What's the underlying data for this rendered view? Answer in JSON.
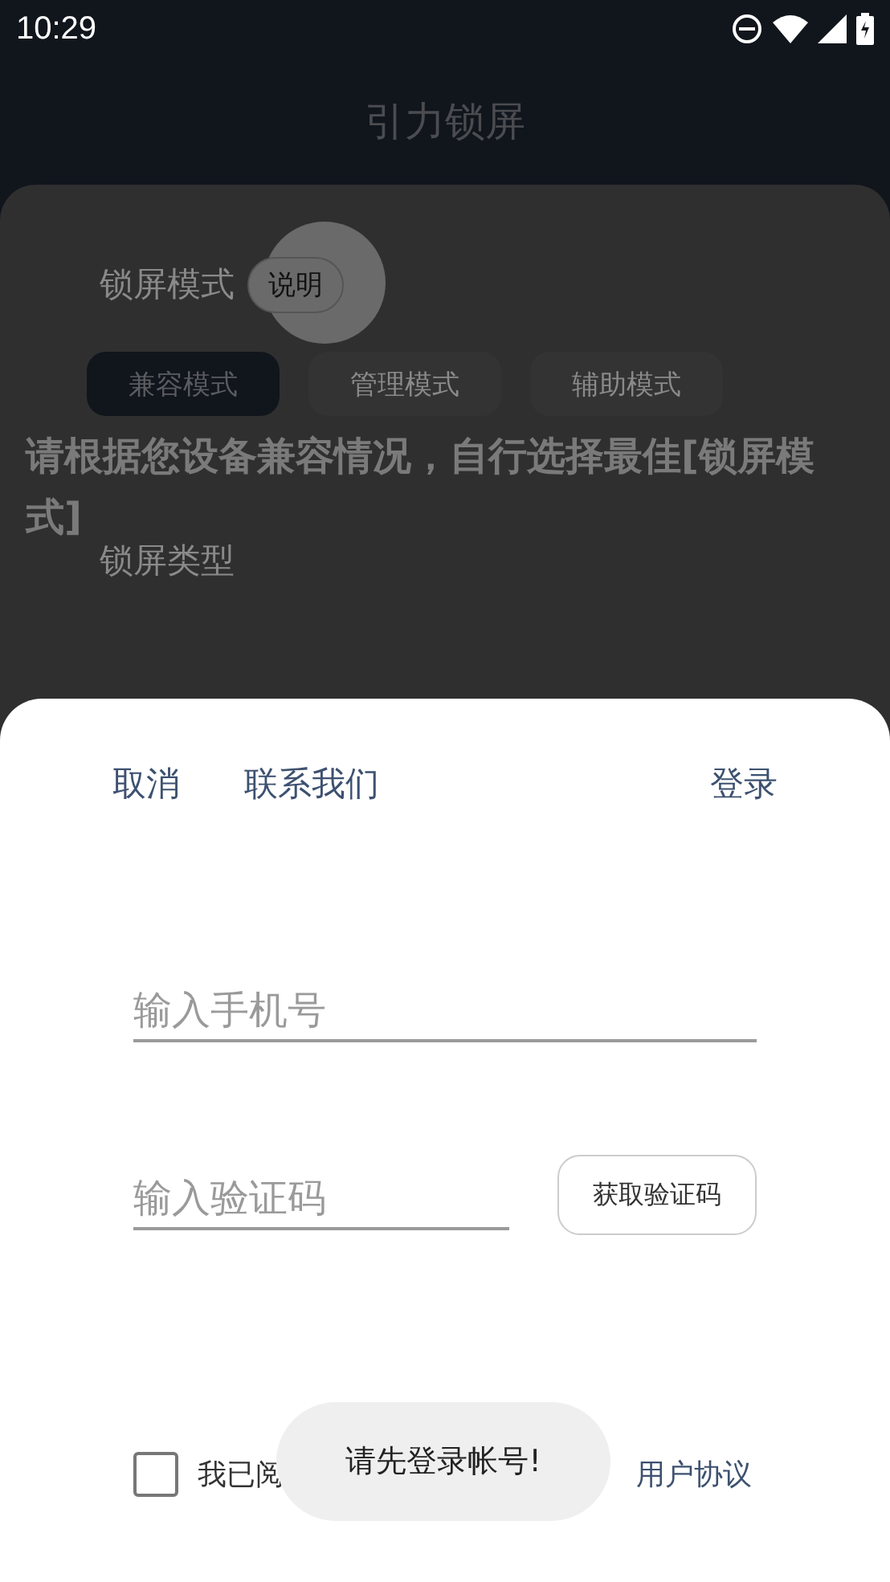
{
  "status_bar": {
    "time": "10:29"
  },
  "header": {
    "title": "引力锁屏"
  },
  "background": {
    "mode_label": "锁屏模式",
    "help_button": "说明",
    "modes": [
      {
        "label": "兼容模式",
        "selected": true
      },
      {
        "label": "管理模式",
        "selected": false
      },
      {
        "label": "辅助模式",
        "selected": false
      }
    ],
    "hint": "请根据您设备兼容情况，自行选择最佳[锁屏模式]",
    "type_label": "锁屏类型"
  },
  "login_sheet": {
    "cancel": "取消",
    "contact": "联系我们",
    "login": "登录",
    "phone_field": {
      "placeholder": "输入手机号"
    },
    "code_field": {
      "placeholder": "输入验证码"
    },
    "get_code_button": "获取验证码",
    "agreement": {
      "checked": false,
      "prefix": "我已阅",
      "terms_link": "用户协议"
    }
  },
  "toast": "请先登录帐号!"
}
